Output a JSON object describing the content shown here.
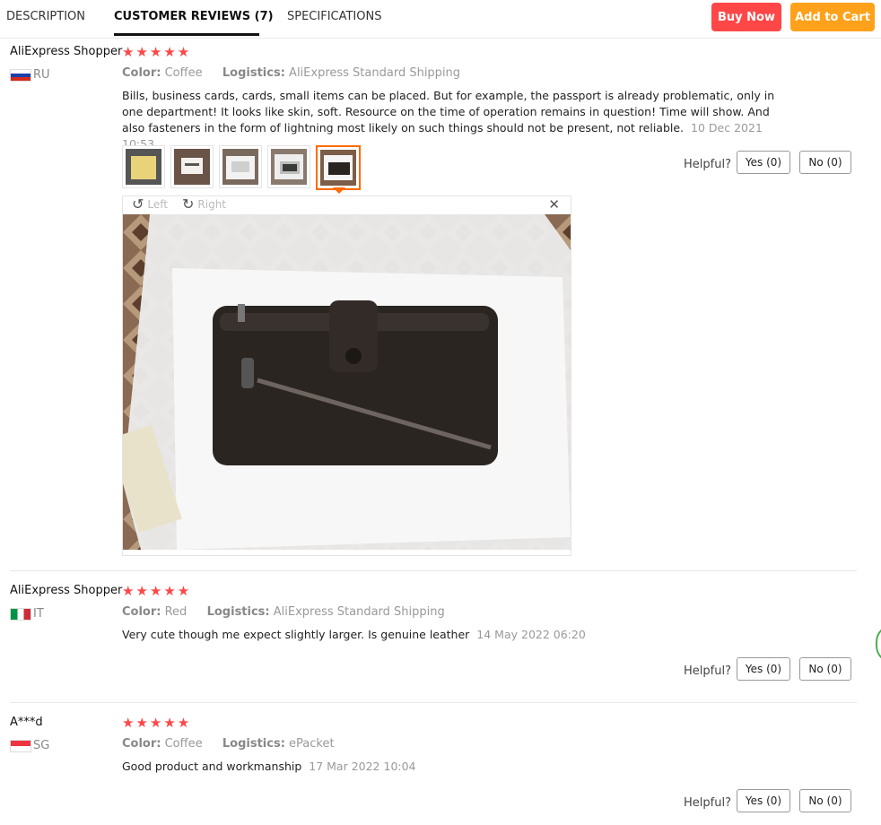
{
  "tabs": [
    {
      "label": "DESCRIPTION"
    },
    {
      "label": "CUSTOMER REVIEWS (7)"
    },
    {
      "label": "SPECIFICATIONS"
    }
  ],
  "actions": {
    "buy_now": "Buy Now",
    "add_to_cart": "Add to Cart"
  },
  "colors": {
    "buy_now": "#ff4747",
    "add_to_cart": "#ffa11a",
    "stars": "#ff4747",
    "active_thumb": "#ff6a00"
  },
  "reviews": [
    {
      "name": "AliExpress Shopper",
      "stars": "★★★★★",
      "rating": 5,
      "country": "RU",
      "color_label": "Color:",
      "color": "Coffee",
      "logistics_label": "Logistics:",
      "logistics": "AliExpress Standard Shipping",
      "text": "Bills, business cards, cards, small items can be placed. But for example, the passport is already problematic, only in one department! It looks like skin, soft. Resource on the time of operation remains in question! Time will show. And also fasteners in the form of lightning most likely on such things should not be present, not reliable.",
      "date": "10 Dec 2021 10:53",
      "helpful": "Helpful?",
      "yes": "Yes (0)",
      "no": "No (0)"
    },
    {
      "name": "AliExpress Shopper",
      "stars": "★★★★★",
      "rating": 5,
      "country": "IT",
      "color_label": "Color:",
      "color": "Red",
      "logistics_label": "Logistics:",
      "logistics": "AliExpress Standard Shipping",
      "text": "Very cute though me expect slightly larger. Is genuine leather",
      "date": "14 May 2022 06:20",
      "helpful": "Helpful?",
      "yes": "Yes (0)",
      "no": "No (0)"
    },
    {
      "name": "A***d",
      "stars": "★★★★★",
      "rating": 5,
      "country": "SG",
      "color_label": "Color:",
      "color": "Coffee",
      "logistics_label": "Logistics:",
      "logistics": "ePacket",
      "text": "Good product and workmanship",
      "date": "17 Mar 2022 10:04",
      "helpful": "Helpful?",
      "yes": "Yes (0)",
      "no": "No (0)"
    }
  ],
  "viewer": {
    "left_label": "Left",
    "right_label": "Right",
    "rotate_left_icon": "rotate-left-icon",
    "rotate_right_icon": "rotate-right-icon",
    "close_icon": "close-icon"
  }
}
